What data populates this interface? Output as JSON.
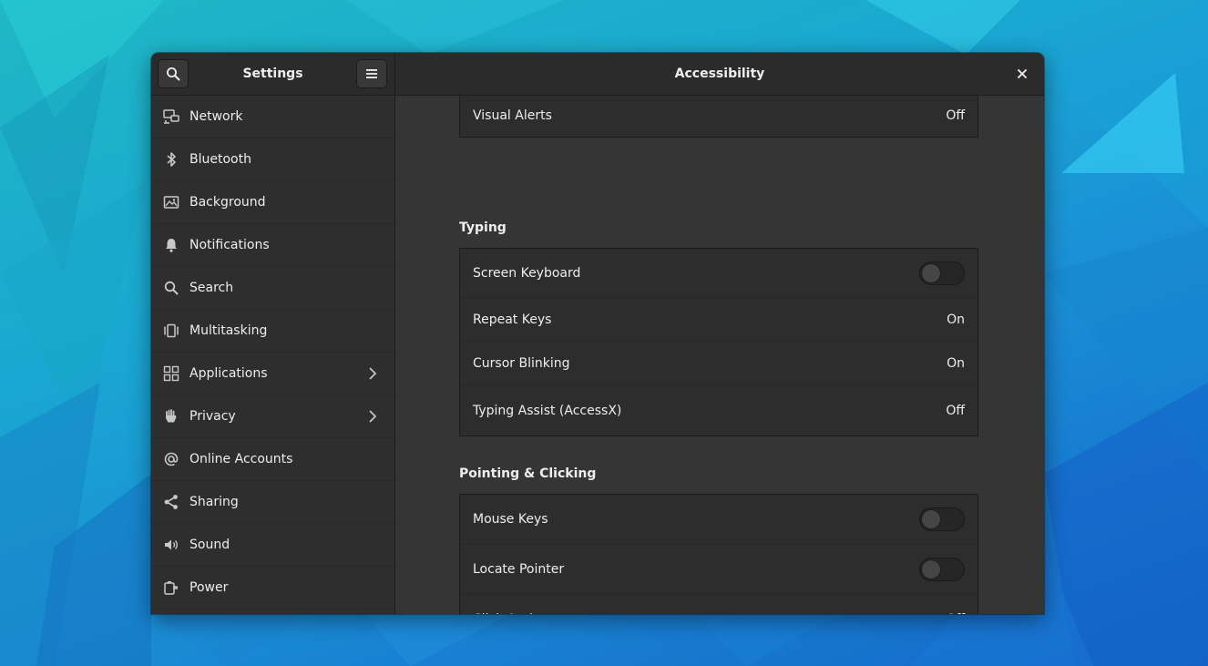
{
  "sidebar": {
    "title": "Settings",
    "items": [
      {
        "label": "Network",
        "icon": "network-icon"
      },
      {
        "label": "Bluetooth",
        "icon": "bluetooth-icon"
      },
      {
        "label": "Background",
        "icon": "background-icon"
      },
      {
        "label": "Notifications",
        "icon": "bell-icon"
      },
      {
        "label": "Search",
        "icon": "search-icon"
      },
      {
        "label": "Multitasking",
        "icon": "multitasking-icon"
      },
      {
        "label": "Applications",
        "icon": "applications-icon",
        "has_submenu": true
      },
      {
        "label": "Privacy",
        "icon": "hand-icon",
        "has_submenu": true
      },
      {
        "label": "Online Accounts",
        "icon": "at-icon"
      },
      {
        "label": "Sharing",
        "icon": "share-icon"
      },
      {
        "label": "Sound",
        "icon": "speaker-icon"
      },
      {
        "label": "Power",
        "icon": "power-plug-icon"
      }
    ]
  },
  "header": {
    "title": "Accessibility"
  },
  "content": {
    "seeing_tail": [
      {
        "label": "Visual Alerts",
        "value": "Off"
      }
    ],
    "typing": {
      "title": "Typing",
      "rows": [
        {
          "label": "Screen Keyboard",
          "toggle": false
        },
        {
          "label": "Repeat Keys",
          "value": "On"
        },
        {
          "label": "Cursor Blinking",
          "value": "On"
        },
        {
          "label": "Typing Assist (AccessX)",
          "value": "Off"
        }
      ]
    },
    "pointing": {
      "title": "Pointing & Clicking",
      "rows": [
        {
          "label": "Mouse Keys",
          "toggle": false
        },
        {
          "label": "Locate Pointer",
          "toggle": false
        },
        {
          "label": "Click Assist",
          "value": "Off"
        }
      ]
    }
  },
  "colors": {
    "window_bg": "#303030",
    "headerbar_bg": "#2b2b2b",
    "text": "#eeeeec"
  }
}
